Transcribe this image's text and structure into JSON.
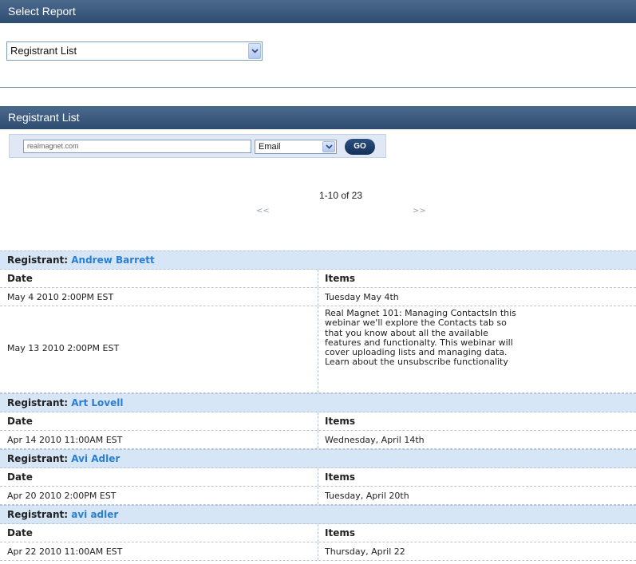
{
  "select_report": {
    "header": "Select Report",
    "selected": "Registrant List"
  },
  "registrant_list": {
    "header": "Registrant List",
    "search_value": "realmagnet.com",
    "field_selected": "Email",
    "go_label": "GO"
  },
  "pager": {
    "count": "1-10 of 23",
    "prev": "<<",
    "next": ">>"
  },
  "columns": {
    "date": "Date",
    "items": "Items"
  },
  "registrants": [
    {
      "label": "Registrant:",
      "name": "Andrew Barrett",
      "rows": [
        {
          "date": "May 4 2010 2:00PM EST",
          "item": "Tuesday May 4th"
        },
        {
          "date": "May 13 2010 2:00PM EST",
          "item": "Real Magnet 101: Managing ContactsIn this webinar we'll explore the Contacts tab so that you know about all the available features and functionalty. This webinar will cover uploading lists and managing data. Learn about the unsubscribe functionality"
        }
      ]
    },
    {
      "label": "Registrant:",
      "name": "Art Lovell",
      "rows": [
        {
          "date": "Apr 14 2010 11:00AM EST",
          "item": "Wednesday, April 14th"
        }
      ]
    },
    {
      "label": "Registrant:",
      "name": "Avi Adler",
      "rows": [
        {
          "date": "Apr 20 2010 2:00PM EST",
          "item": "Tuesday, April 20th"
        }
      ]
    },
    {
      "label": "Registrant:",
      "name": "avi adler",
      "rows": [
        {
          "date": "Apr 22 2010 11:00AM EST",
          "item": "Thursday, April 22"
        }
      ]
    }
  ],
  "colors": {
    "header_bg": "#2f4d70",
    "registrant_row_bg": "#d6e6f7",
    "link": "#2a7fd0",
    "go_button": "#14305a"
  },
  "icons": {
    "dropdown": "chevron-down-icon"
  }
}
